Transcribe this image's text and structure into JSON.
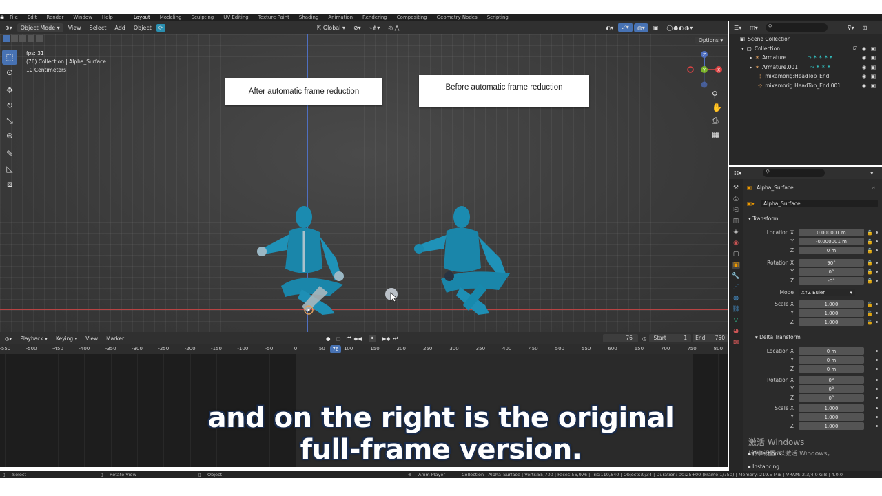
{
  "menu_bar": {
    "items": [
      "File",
      "Edit",
      "Render",
      "Window",
      "Help"
    ],
    "workspaces": [
      "Layout",
      "Modeling",
      "Sculpting",
      "UV Editing",
      "Texture Paint",
      "Shading",
      "Animation",
      "Rendering",
      "Compositing",
      "Geometry Nodes",
      "Scripting"
    ],
    "active_workspace": "Layout"
  },
  "viewport_header": {
    "mode": "Object Mode",
    "menus": [
      "View",
      "Select",
      "Add",
      "Object"
    ],
    "transform_orientation": "Global",
    "options_label": "Options"
  },
  "viewport": {
    "info_lines": [
      "fps: 31",
      "(76) Collection | Alpha_Surface",
      "10 Centimeters"
    ],
    "label_left": "After automatic frame reduction",
    "label_right": "Before automatic frame reduction",
    "gizmo": {
      "x": "X",
      "y": "Y",
      "z": "Z"
    }
  },
  "outliner": {
    "root": "Scene Collection",
    "collection": "Collection",
    "items": [
      "Armature",
      "Armature.001",
      "mixamorig:HeadTop_End",
      "mixamorig:HeadTop_End.001"
    ]
  },
  "properties": {
    "object_name": "Alpha_Surface",
    "data_name": "Alpha_Surface",
    "transform_label": "Transform",
    "location_label": "Location X",
    "location": [
      "0.000001 m",
      "-0.000001 m",
      "0 m"
    ],
    "rotation_label": "Rotation X",
    "rotation": [
      "90°",
      "0°",
      "-0°"
    ],
    "mode_label": "Mode",
    "mode_value": "XYZ Euler",
    "scale_label": "Scale X",
    "scale": [
      "1.000",
      "1.000",
      "1.000"
    ],
    "delta_label": "Delta Transform",
    "delta_location": [
      "0 m",
      "0 m",
      "0 m"
    ],
    "delta_rotation": [
      "0°",
      "0°",
      "0°"
    ],
    "delta_scale": [
      "1.000",
      "1.000",
      "1.000"
    ],
    "axis_y": "Y",
    "axis_z": "Z",
    "collections_label": "Collections",
    "instancing_label": "Instancing"
  },
  "timeline": {
    "menus": [
      "Playback",
      "Keying",
      "View",
      "Marker"
    ],
    "current_frame": "76",
    "start_label": "Start",
    "start_value": "1",
    "end_label": "End",
    "end_value": "750",
    "ruler_ticks": [
      "-550",
      "-500",
      "-450",
      "-400",
      "-350",
      "-300",
      "-250",
      "-200",
      "-150",
      "-100",
      "-50",
      "0",
      "50",
      "100",
      "150",
      "200",
      "250",
      "300",
      "350",
      "400",
      "450",
      "500",
      "550",
      "600",
      "650",
      "700",
      "750",
      "800"
    ]
  },
  "status_bar": {
    "select": "Select",
    "rotate": "Rotate View",
    "object": "Object",
    "app": "Anim Player",
    "stats": "Collection | Alpha_Surface | Verts:55,700 | Faces:56,976 | Tris:110,640 | Objects:0/34 | Duration: 00:25+00 (Frame 1/750) | Memory: 219.5 MiB | VRAM: 2.3/4.0 GiB | 4.0.0"
  },
  "subtitle": {
    "line1": "and on the right is the original",
    "line2": "full-frame version."
  },
  "watermark": {
    "line1": "激活 Windows",
    "line2": "转到\"设置\"以激活 Windows。"
  },
  "colors": {
    "accent": "#4772b3",
    "x_axis": "#b84343",
    "y_axis": "#7ab32a",
    "z_axis": "#4f6fc0",
    "figure": "#1f8fb0"
  }
}
